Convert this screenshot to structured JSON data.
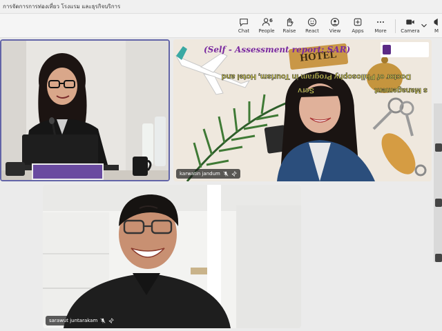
{
  "window": {
    "title": "การจัดการการท่องเที่ยว โรงแรม และธุรกิจบริการ"
  },
  "toolbar": {
    "chat": "Chat",
    "people": "People",
    "people_count": "6",
    "raise": "Raise",
    "react": "React",
    "view": "View",
    "apps": "Apps",
    "more": "More",
    "camera": "Camera",
    "mic_partial": "M"
  },
  "participants": [
    {
      "name": ""
    },
    {
      "name": "karwatin jandum"
    },
    {
      "name": "sarawut juntarakam"
    }
  ],
  "slide": {
    "title": "(Self - Assessment report: SAR)",
    "hotel_sign": "HOTEL",
    "line1": "Doctor of Philosophy Program in Tourism, Hotel and",
    "line2": "Serv",
    "line2b": "s Management"
  },
  "colors": {
    "accent": "#6264a7",
    "slide_title": "#7a2aa0",
    "slide_text": "#e9e24a"
  }
}
